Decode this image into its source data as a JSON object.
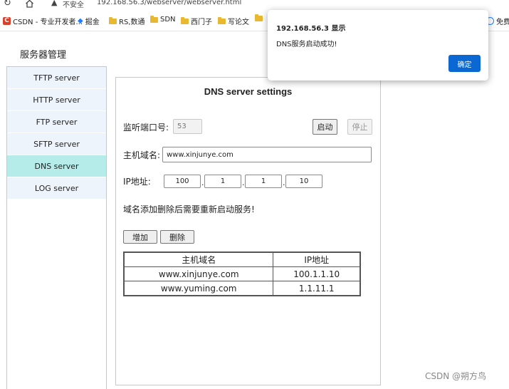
{
  "browser": {
    "security_label": "不安全",
    "url": "192.168.56.3/webserver/webserver.html",
    "bookmarks": [
      {
        "label": "CSDN - 专业开发者..."
      },
      {
        "label": "掘金"
      },
      {
        "label": "RS,数通"
      },
      {
        "label": "SDN"
      },
      {
        "label": "西门子"
      },
      {
        "label": "写论文"
      },
      {
        "label": "免费"
      }
    ]
  },
  "page_title": "服务器管理",
  "sidebar": {
    "items": [
      {
        "label": "TFTP server",
        "active": false
      },
      {
        "label": "HTTP server",
        "active": false
      },
      {
        "label": "FTP server",
        "active": false
      },
      {
        "label": "SFTP server",
        "active": false
      },
      {
        "label": "DNS server",
        "active": true
      },
      {
        "label": "LOG server",
        "active": false
      }
    ]
  },
  "panel": {
    "title": "DNS server settings",
    "port_label": "监听端口号:",
    "port_value": "53",
    "start_button": "启动",
    "stop_button": "停止",
    "domain_label": "主机域名:",
    "domain_value": "www.xinjunye.com",
    "ip_label": "IP地址:",
    "ip_octets": [
      "100",
      "1",
      "1",
      "10"
    ],
    "ip_separator": ".",
    "notice": "域名添加删除后需要重新启动服务!",
    "add_button": "增加",
    "delete_button": "删除",
    "table": {
      "headers": [
        "主机域名",
        "IP地址"
      ],
      "rows": [
        [
          "www.xinjunye.com",
          "100.1.1.10"
        ],
        [
          "www.yuming.com",
          "1.1.11.1"
        ]
      ]
    }
  },
  "dialog": {
    "title": "192.168.56.3 显示",
    "message": "DNS服务启动成功!",
    "ok_button": "确定"
  },
  "watermark": "CSDN @朔方鸟",
  "colors": {
    "sidebar_bg": "#eef4fb",
    "sidebar_active": "#b5ece9",
    "dialog_button": "#0b67d1",
    "csdn_red": "#d8412b"
  }
}
